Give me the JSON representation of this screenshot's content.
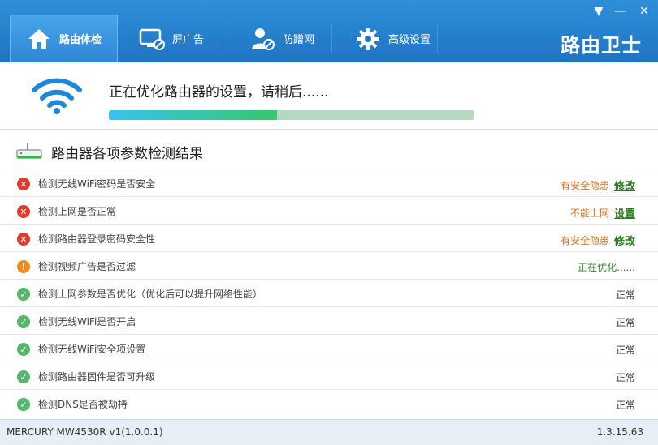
{
  "header": {
    "tabs": [
      {
        "label": "路由体检",
        "icon": "home-icon",
        "active": true
      },
      {
        "label": "屏广告",
        "icon": "monitor-block-icon",
        "active": false
      },
      {
        "label": "防蹭网",
        "icon": "user-block-icon",
        "active": false
      },
      {
        "label": "高级设置",
        "icon": "gear-icon",
        "active": false
      }
    ],
    "brand": "路由卫士",
    "window_buttons": {
      "menu": "▼",
      "minimize": "—",
      "close": "✕"
    }
  },
  "progress": {
    "status": "正在优化路由器的设置，请稍后......",
    "percent": 46
  },
  "section": {
    "title": "路由器各项参数检测结果"
  },
  "checks": [
    {
      "label": "检测无线WiFi密码是否安全",
      "state": "error",
      "result": "有安全隐患",
      "action": "修改"
    },
    {
      "label": "检测上网是否正常",
      "state": "error",
      "result": "不能上网",
      "action": "设置"
    },
    {
      "label": "检测路由器登录密码安全性",
      "state": "error",
      "result": "有安全隐患",
      "action": "修改"
    },
    {
      "label": "检测视频广告是否过滤",
      "state": "warn",
      "result": "正在优化......",
      "action": ""
    },
    {
      "label": "检测上网参数是否优化（优化后可以提升网络性能）",
      "state": "ok",
      "result": "正常",
      "action": ""
    },
    {
      "label": "检测无线WiFi是否开启",
      "state": "ok",
      "result": "正常",
      "action": ""
    },
    {
      "label": "检测无线WiFi安全项设置",
      "state": "ok",
      "result": "正常",
      "action": ""
    },
    {
      "label": "检测路由器固件是否可升级",
      "state": "ok",
      "result": "正常",
      "action": ""
    },
    {
      "label": "检测DNS是否被劫持",
      "state": "ok",
      "result": "正常",
      "action": ""
    }
  ],
  "footer": {
    "model": "MERCURY MW4530R v1(1.0.0.1)",
    "version": "1.3.15.63"
  },
  "colors": {
    "header": "#1f74c4",
    "progress_start": "#39c3ef",
    "progress_end": "#36c86a"
  }
}
